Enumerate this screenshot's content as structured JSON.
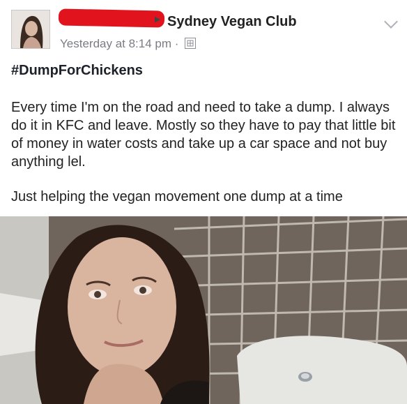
{
  "post": {
    "group_name": "Sydney Vegan Club",
    "timestamp": "Yesterday at 8:14 pm",
    "separator": "·",
    "hashtag": "#DumpForChickens",
    "paragraph_1": "Every time I'm on the road and need to take a dump. I always do it in KFC and leave. Mostly so they have to pay that little bit of money in water costs and take up a car space and not buy anything lel.",
    "paragraph_2": "Just helping the vegan movement one dump at a time"
  },
  "icons": {
    "share_arrow": "arrow-right-icon",
    "audience": "globe-icon",
    "menu": "chevron-down-icon"
  },
  "colors": {
    "redaction": "#e1141e",
    "text": "#1d2129",
    "meta": "#7a7d84"
  }
}
